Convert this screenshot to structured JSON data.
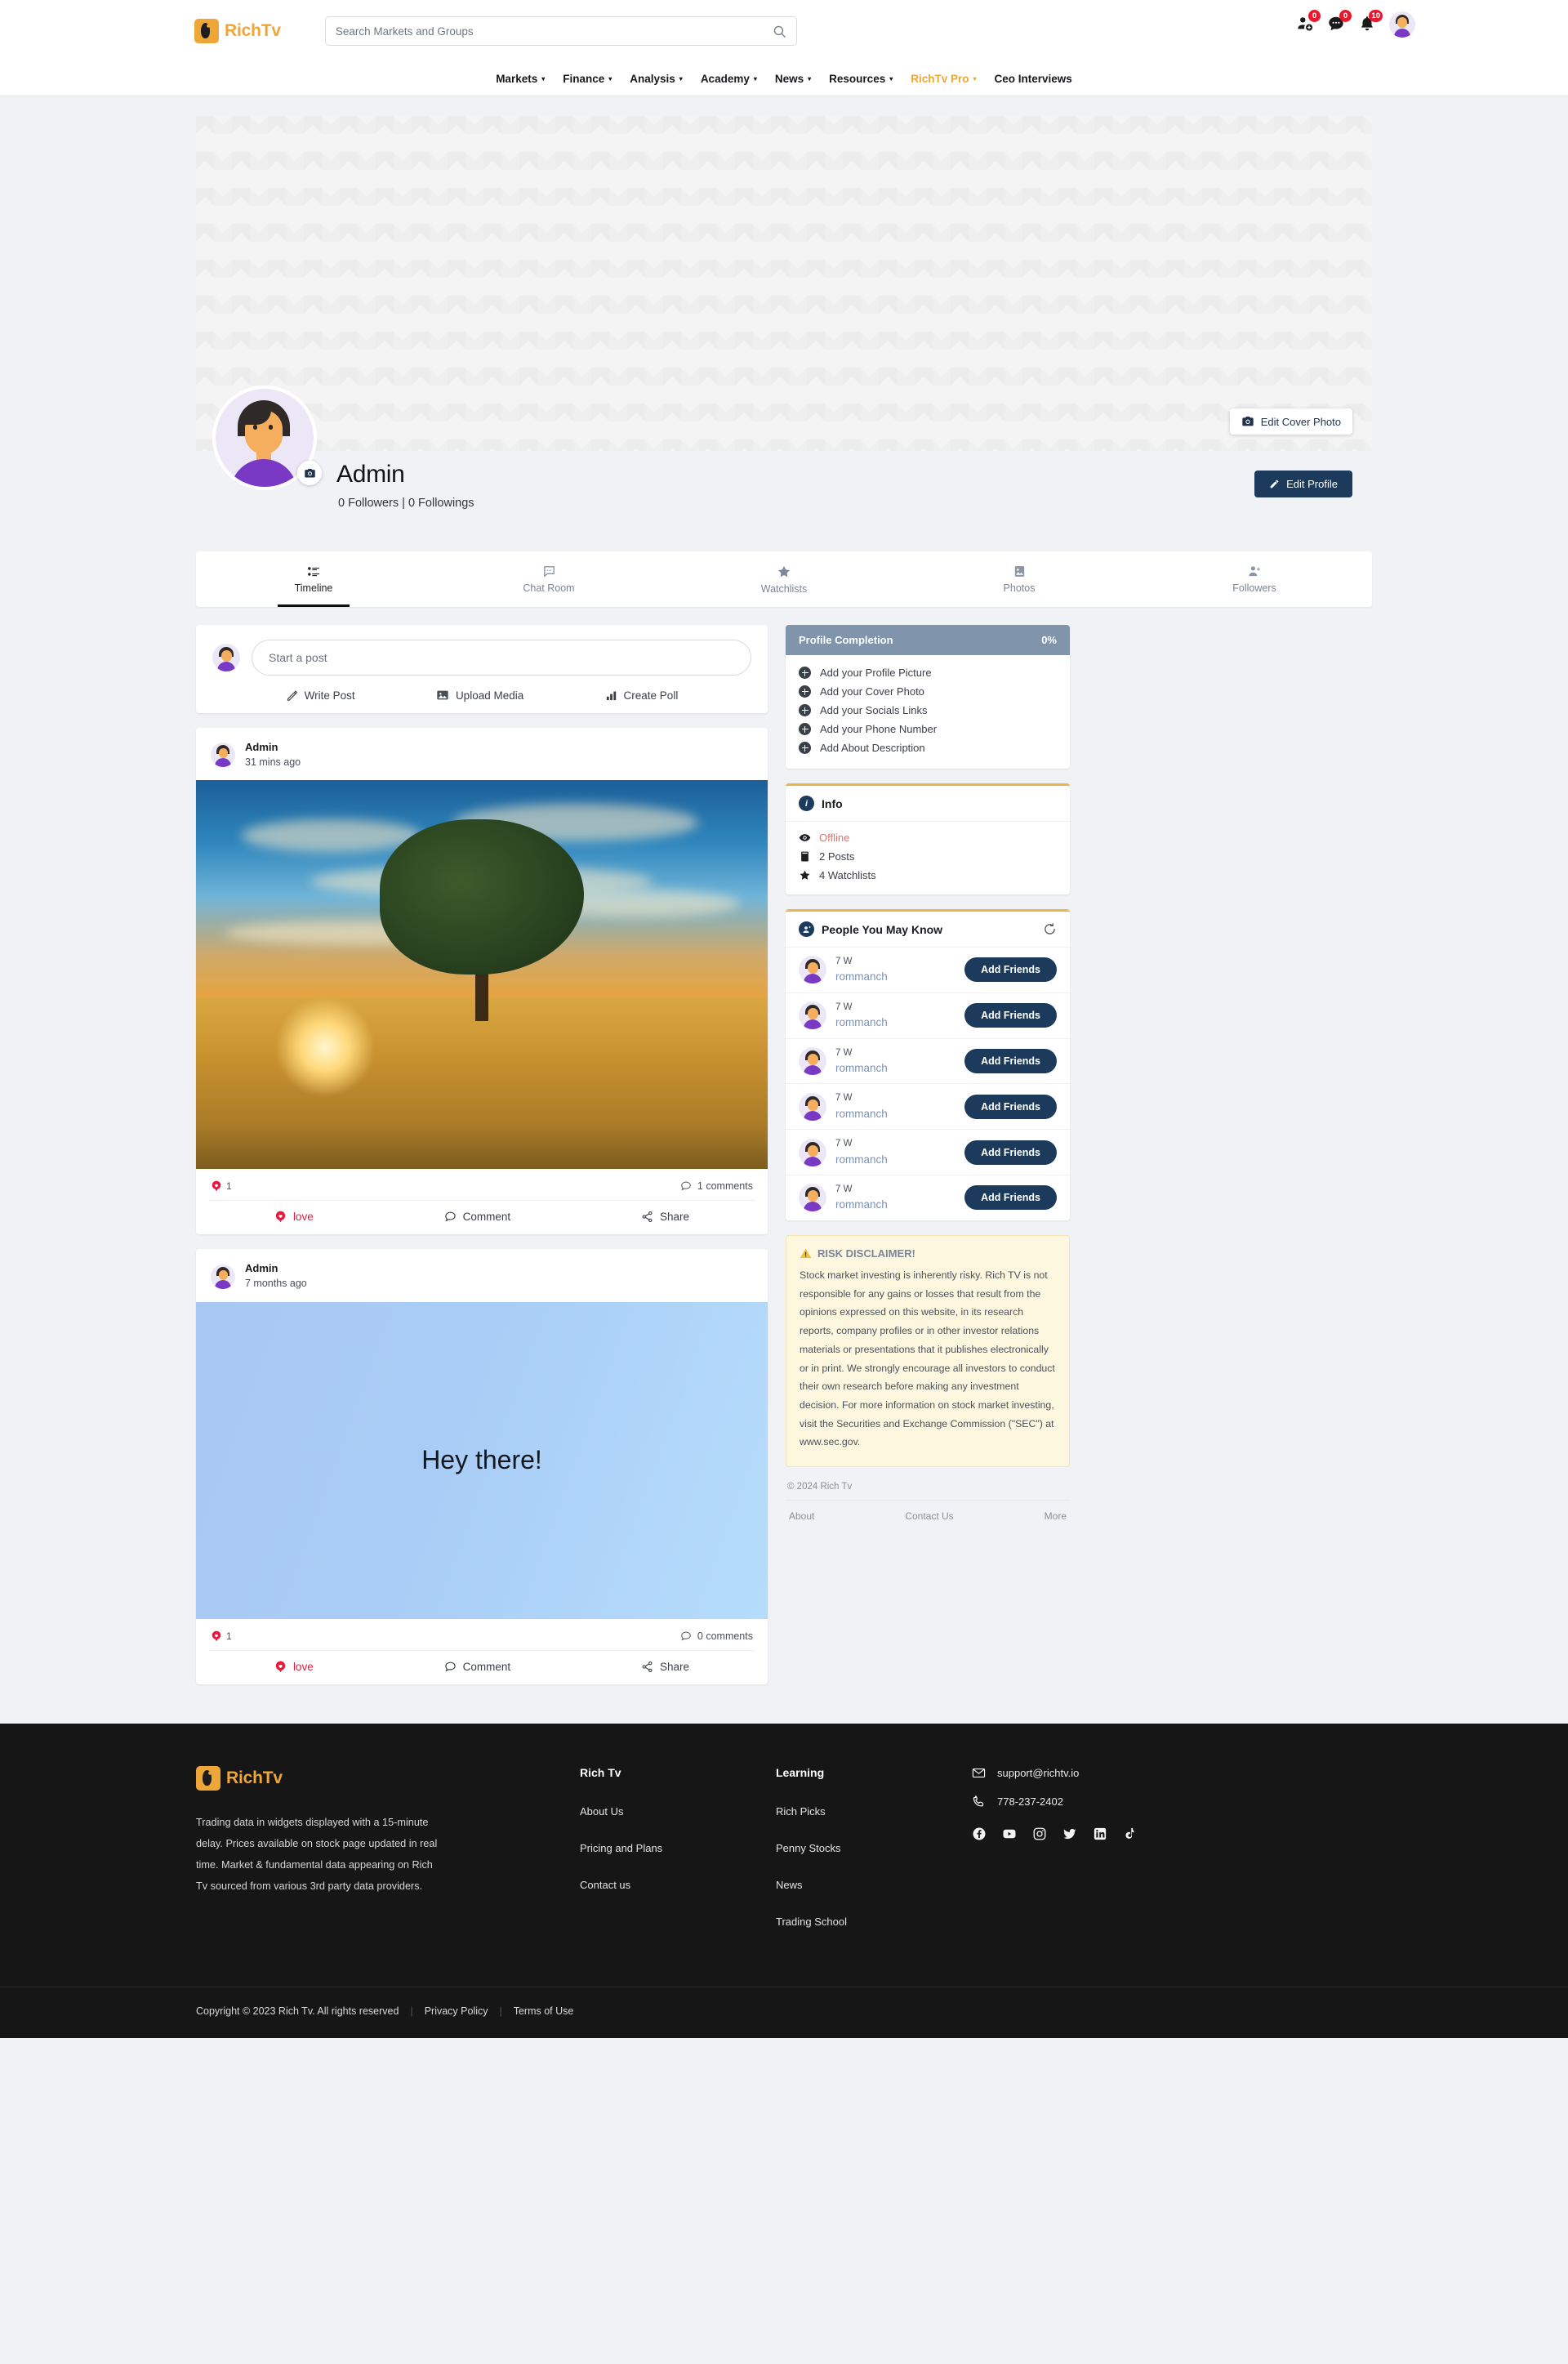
{
  "header": {
    "logo_text_rich": "Rich",
    "logo_text_tv": "Tv",
    "search_placeholder": "Search Markets and Groups",
    "search_value": "",
    "badges": {
      "friend_requests": "0",
      "messages": "0",
      "notifications": "10"
    },
    "nav": [
      {
        "label": "Markets",
        "caret": "▾",
        "pro": false
      },
      {
        "label": "Finance",
        "caret": "▾",
        "pro": false
      },
      {
        "label": "Analysis",
        "caret": "▾",
        "pro": false
      },
      {
        "label": "Academy",
        "caret": "▾",
        "pro": false
      },
      {
        "label": "News",
        "caret": "▾",
        "pro": false
      },
      {
        "label": "Resources",
        "caret": "▾",
        "pro": false
      },
      {
        "label": "RichTv Pro",
        "caret": "▾",
        "pro": true
      },
      {
        "label": "Ceo Interviews",
        "caret": "",
        "pro": false
      }
    ]
  },
  "profile": {
    "edit_cover_label": "Edit Cover Photo",
    "name": "Admin",
    "stats": "0 Followers | 0 Followings",
    "edit_profile_label": "Edit Profile",
    "tabs": [
      {
        "label": "Timeline",
        "icon": "timeline-icon",
        "active": true
      },
      {
        "label": "Chat Room",
        "icon": "chat-icon",
        "active": false
      },
      {
        "label": "Watchlists",
        "icon": "star-icon",
        "active": false
      },
      {
        "label": "Photos",
        "icon": "photo-icon",
        "active": false
      },
      {
        "label": "Followers",
        "icon": "followers-icon",
        "active": false
      }
    ]
  },
  "composer": {
    "placeholder": "Start a post",
    "value": "",
    "actions": [
      {
        "label": "Write Post",
        "icon": "pencil-icon"
      },
      {
        "label": "Upload Media",
        "icon": "image-icon"
      },
      {
        "label": "Create Poll",
        "icon": "bar-chart-icon"
      }
    ]
  },
  "posts": [
    {
      "author": "Admin",
      "time": "31 mins ago",
      "type": "image",
      "text": "",
      "likes": "1",
      "comments": "1 comments",
      "actions": {
        "love": "love",
        "comment": "Comment",
        "share": "Share"
      }
    },
    {
      "author": "Admin",
      "time": "7 months ago",
      "type": "text",
      "text": "Hey there!",
      "likes": "1",
      "comments": "0 comments",
      "actions": {
        "love": "love",
        "comment": "Comment",
        "share": "Share"
      }
    }
  ],
  "profile_completion": {
    "title": "Profile Completion",
    "percent": "0%",
    "items": [
      "Add your Profile Picture",
      "Add your Cover Photo",
      "Add your Socials Links",
      "Add your Phone Number",
      "Add About Description"
    ]
  },
  "info": {
    "title": "Info",
    "status": "Offline",
    "posts": "2 Posts",
    "watchlists": "4 Watchlists"
  },
  "people": {
    "title": "People You May Know",
    "refresh_icon": "refresh-icon",
    "items": [
      {
        "time": "7 W",
        "name": "rommanch",
        "button": "Add Friends"
      },
      {
        "time": "7 W",
        "name": "rommanch",
        "button": "Add Friends"
      },
      {
        "time": "7 W",
        "name": "rommanch",
        "button": "Add Friends"
      },
      {
        "time": "7 W",
        "name": "rommanch",
        "button": "Add Friends"
      },
      {
        "time": "7 W",
        "name": "rommanch",
        "button": "Add Friends"
      },
      {
        "time": "7 W",
        "name": "rommanch",
        "button": "Add Friends"
      }
    ]
  },
  "disclaimer": {
    "title": "RISK DISCLAIMER!",
    "body": "Stock market investing is inherently risky. Rich TV is not responsible for any gains or losses that result from the opinions expressed on this website, in its research reports, company profiles or in other investor relations materials or presentations that it publishes electronically or in print. We strongly encourage all investors to conduct their own research before making any investment decision. For more information on stock market investing, visit the Securities and Exchange Commission (\"SEC\") at www.sec.gov."
  },
  "sidebar_footer": {
    "copyright": "© 2024 Rich Tv",
    "links": [
      "About",
      "Contact Us",
      "More"
    ]
  },
  "footer": {
    "logo_text_rich": "Rich",
    "logo_text_tv": "Tv",
    "about": "Trading data in widgets displayed with a 15-minute delay. Prices available on stock page updated in real time. Market & fundamental data appearing on Rich Tv sourced from various 3rd party data providers.",
    "col1": {
      "head": "Rich Tv",
      "links": [
        "About Us",
        "Pricing and Plans",
        "Contact us"
      ]
    },
    "col2": {
      "head": "Learning",
      "links": [
        "Rich Picks",
        "Penny Stocks",
        "News",
        "Trading School"
      ]
    },
    "email": "support@richtv.io",
    "phone": "778-237-2402",
    "socials": [
      "facebook-icon",
      "youtube-icon",
      "instagram-icon",
      "twitter-icon",
      "linkedin-icon",
      "tiktok-icon"
    ],
    "bottom": {
      "copyright": "Copyright © 2023 Rich Tv. All rights reserved",
      "privacy": "Privacy Policy",
      "terms": "Terms of Use"
    }
  },
  "colors": {
    "brand": "#efa638",
    "dark_blue": "#1b3a5c",
    "love_red": "#e8193f",
    "badge_red": "#e8192c",
    "panel_header": "#8094ab"
  }
}
